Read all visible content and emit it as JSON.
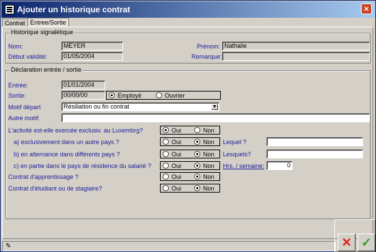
{
  "window": {
    "title": "Ajouter un historique contrat",
    "close_label": "×"
  },
  "tabs": [
    {
      "label": "Contrat"
    },
    {
      "label": "Entree/Sortie"
    }
  ],
  "signaletique": {
    "group_title": "Historique signalétique",
    "nom_label": "Nom:",
    "nom_value": "MEYER",
    "prenom_label": "Prénom:",
    "prenom_value": "Nathalie",
    "debut_label": "Début validité:",
    "debut_value": "01/05/2004",
    "remarque_label": "Remarque:",
    "remarque_value": ""
  },
  "declaration": {
    "group_title": "Déclaration entrée / sortie",
    "entree_label": "Entrée:",
    "entree_value": "01/01/2004",
    "sortie_label": "Sortie:",
    "sortie_value": "00/00/00",
    "employe_label": "Employé",
    "ouvrier_label": "Ouvrier",
    "statut_selected": "Employé",
    "motif_label": "Motif départ",
    "motif_value": "Résiliation ou fin contrat",
    "autre_label": "Autre motif:",
    "autre_value": "",
    "oui": "Oui",
    "non": "Non",
    "q1": {
      "label": "L'activité est-elle exercée exclusiv. au Luxembrg?",
      "selected": "Oui"
    },
    "q2": {
      "label": "a) exclusivement dans un autre pays ?",
      "selected": "Non",
      "side_label": "Lequel ?",
      "side_value": ""
    },
    "q3": {
      "label": "b) en alternance dans différents pays ?",
      "selected": "Non",
      "side_label": "Lesquels?",
      "side_value": ""
    },
    "q4": {
      "label": "c) en partie dans le pays de résidence du salarié ?",
      "selected": "Non",
      "side_label": "Hrs. / semaine:",
      "side_value": "0"
    },
    "q5": {
      "label": "Contrat d'apprentissage ?",
      "selected": "Non"
    },
    "q6": {
      "label": "Contrat d'étudiant ou de stagiaire?",
      "selected": "Non"
    }
  },
  "buttons": {
    "cancel_label": "✕",
    "ok_label": "✓"
  },
  "status": {
    "icon": "pencil-icon",
    "icon_glyph": "✎"
  },
  "colors": {
    "title_start": "#0a246a",
    "title_end": "#a6caf0",
    "face": "#d4d0c8",
    "cancel": "#e0201e",
    "ok": "#2a9a2a"
  }
}
